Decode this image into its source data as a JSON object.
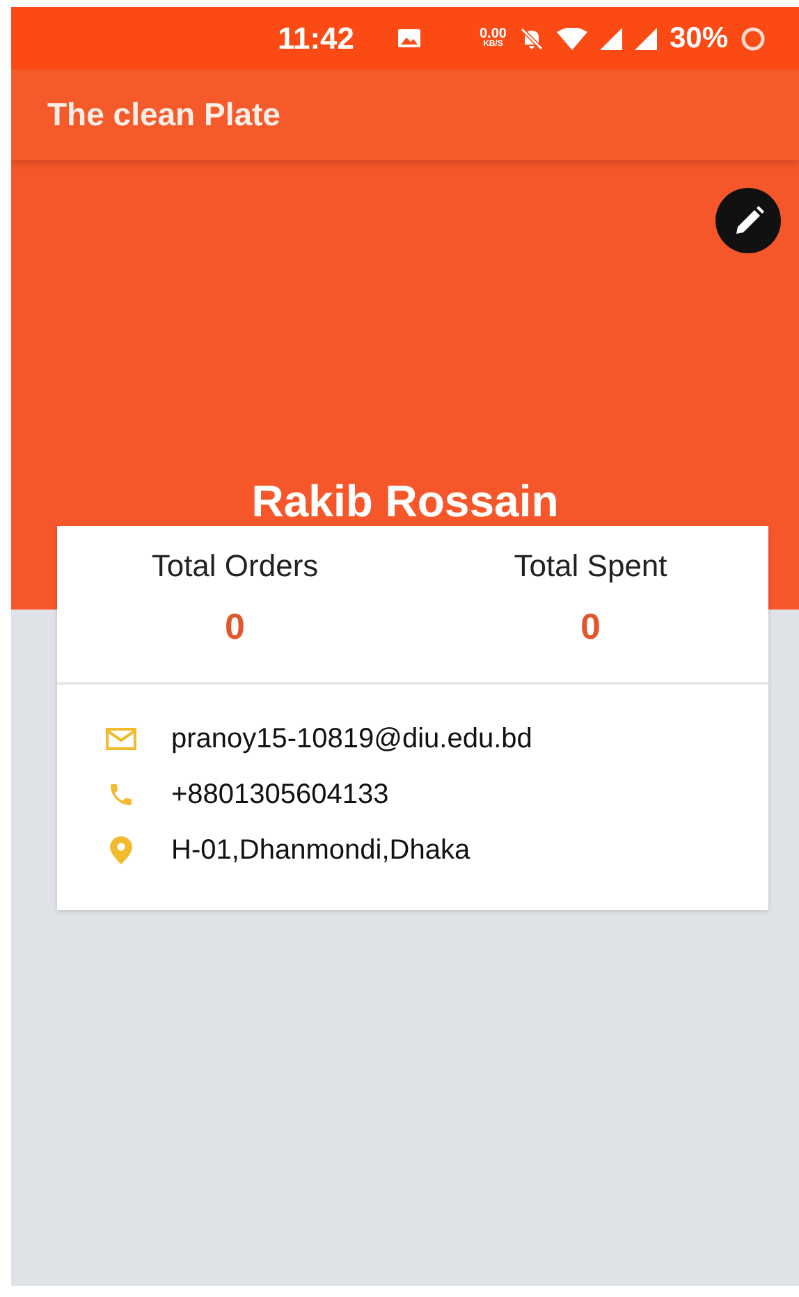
{
  "status_bar": {
    "time": "11:42",
    "speed": "0.00",
    "speed_unit": "KB/S",
    "battery": "30%"
  },
  "app_bar": {
    "title": "The clean Plate"
  },
  "profile": {
    "name": "Rakib Rossain"
  },
  "stats": [
    {
      "label": "Total Orders",
      "value": "0"
    },
    {
      "label": "Total Spent",
      "value": "0"
    }
  ],
  "contacts": [
    {
      "kind": "email",
      "text": "pranoy15-10819@diu.edu.bd"
    },
    {
      "kind": "phone",
      "text": "+8801305604133"
    },
    {
      "kind": "location",
      "text": "H-01,Dhanmondi,Dhaka"
    }
  ]
}
